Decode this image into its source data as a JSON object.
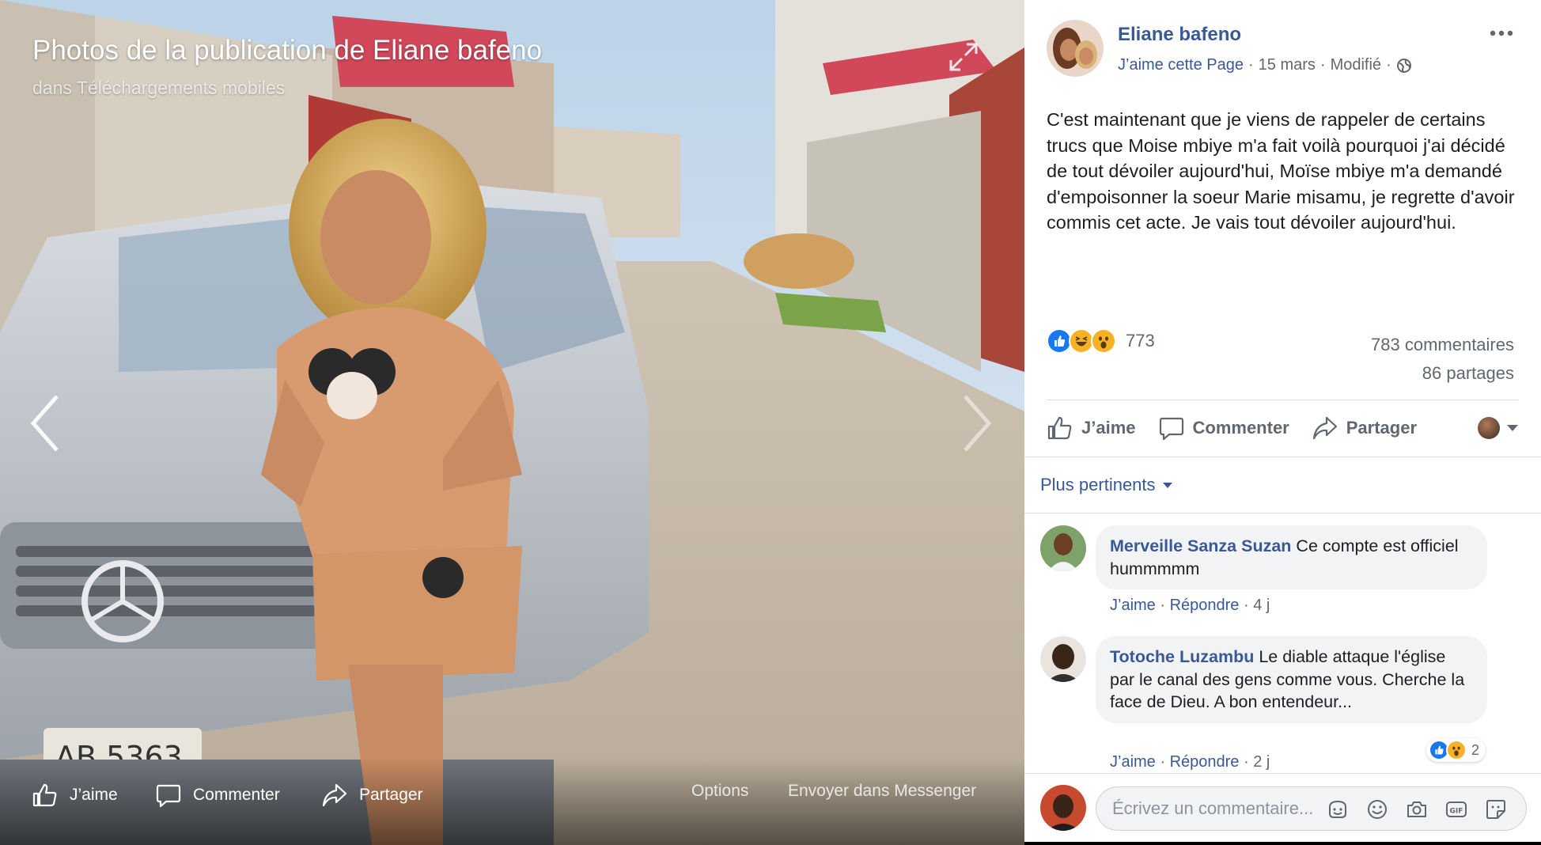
{
  "photo": {
    "title": "Photos de la publication de Eliane bafeno",
    "album_prefix": "dans",
    "album_name": "Téléchargements mobiles",
    "bar": {
      "like": "J’aime",
      "comment": "Commenter",
      "share": "Partager",
      "options": "Options",
      "messenger": "Envoyer dans Messenger"
    }
  },
  "post": {
    "author": "Eliane bafeno",
    "page_like": "J’aime cette Page",
    "date": "15 mars",
    "modified": "Modifié",
    "sep": "·",
    "text": "C'est maintenant que je viens de rappeler de certains trucs que Moise mbiye m'a fait voilà pourquoi j'ai décidé de tout dévoiler aujourd'hui, Moïse mbiye m'a demandé d'empoisonner la soeur Marie misamu, je regrette d'avoir commis cet acte. Je vais tout dévoiler aujourd'hui.",
    "reaction_count": "773",
    "reaction_icons": [
      "like-icon",
      "haha-icon",
      "wow-icon"
    ],
    "comments_count": "783 commentaires",
    "shares_count": "86 partages",
    "actions": {
      "like": "J’aime",
      "comment": "Commenter",
      "share": "Partager"
    }
  },
  "sort": {
    "label": "Plus pertinents"
  },
  "comments": [
    {
      "author": "Merveille Sanza Suzan",
      "text": "Ce compte est officiel hummmmm",
      "like": "J’aime",
      "reply": "Répondre",
      "time": "4 j"
    },
    {
      "author": "Totoche Luzambu",
      "text": "Le diable attaque l'église par le canal des gens comme vous. Cherche la face de Dieu. A bon entendeur...",
      "like": "J’aime",
      "reply": "Répondre",
      "time": "2 j",
      "reaction_count": "2"
    }
  ],
  "composer": {
    "placeholder": "Écrivez un commentaire..."
  },
  "colors": {
    "link": "#385898",
    "secondary_text": "#606770",
    "bubble": "#f2f3f5",
    "like_blue": "#1877f2",
    "reaction_yellow": "#f7b125"
  }
}
